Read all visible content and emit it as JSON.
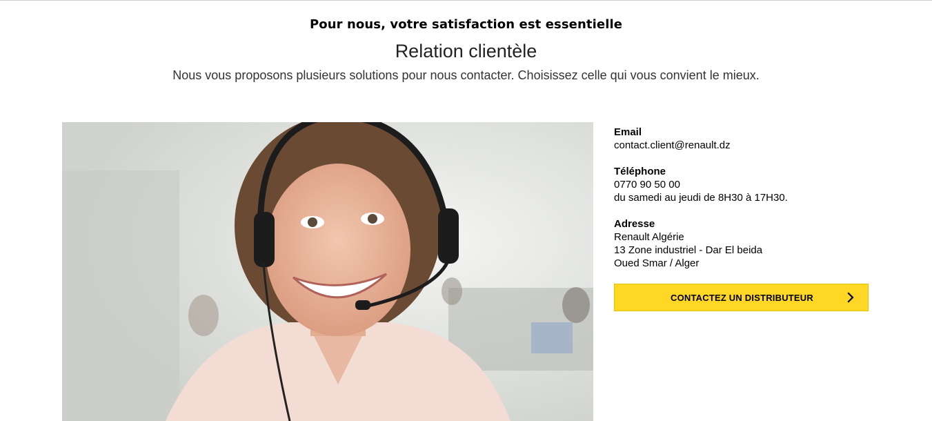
{
  "header": {
    "kicker": "Pour nous, votre satisfaction est essentielle",
    "title": "Relation clientèle",
    "subtitle": "Nous vous proposons plusieurs solutions pour nous contacter. Choisissez celle qui vous convient le mieux."
  },
  "contact": {
    "email_label": "Email",
    "email_value": "contact.client@renault.dz",
    "phone_label": "Téléphone",
    "phone_value": "0770 90 50 00",
    "phone_hours": "du samedi au jeudi de 8H30 à 17H30.",
    "address_label": "Adresse",
    "address_line1": "Renault Algérie",
    "address_line2": "13 Zone industriel - Dar El beida",
    "address_line3": "Oued Smar / Alger"
  },
  "cta": {
    "label": "CONTACTEZ UN DISTRIBUTEUR",
    "icon": "chevron-right-icon"
  },
  "colors": {
    "accent": "#ffd724"
  }
}
